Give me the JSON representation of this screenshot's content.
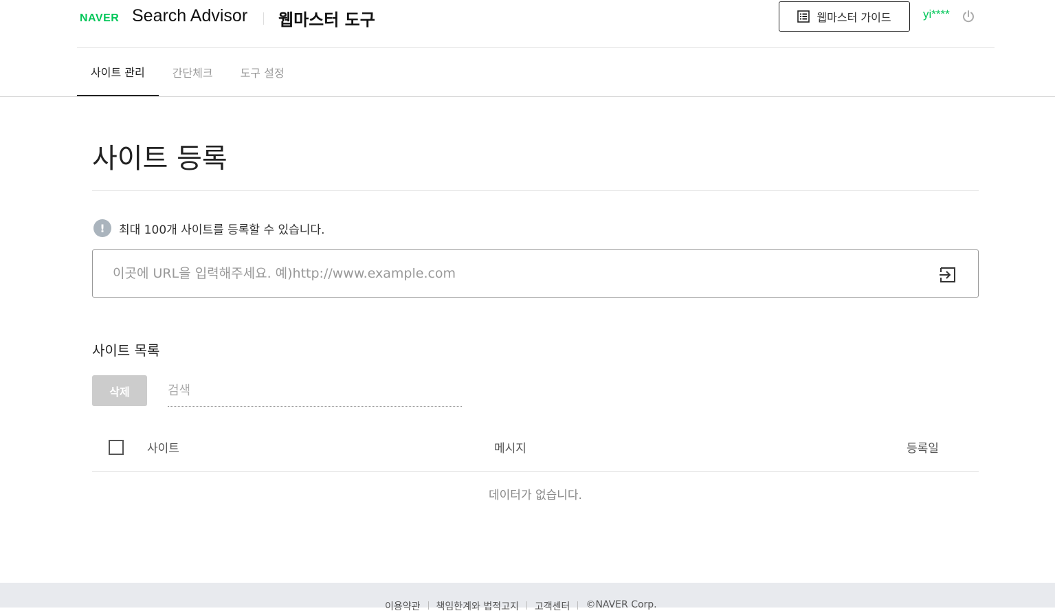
{
  "header": {
    "logo": "NAVER",
    "brand": "Search Advisor",
    "tool_title": "웹마스터 도구",
    "guide_label": "웹마스터 가이드",
    "user": "yi****"
  },
  "tabs": [
    {
      "label": "사이트 관리",
      "active": true
    },
    {
      "label": "간단체크",
      "active": false
    },
    {
      "label": "도구 설정",
      "active": false
    }
  ],
  "main": {
    "title": "사이트 등록",
    "notice": "최대 100개 사이트를 등록할 수 있습니다.",
    "url_placeholder": "이곳에 URL을 입력해주세요. 예)http://www.example.com",
    "list_title": "사이트 목록",
    "delete_label": "삭제",
    "search_placeholder": "검색",
    "columns": {
      "site": "사이트",
      "message": "메시지",
      "date": "등록일"
    },
    "empty_text": "데이터가 없습니다."
  },
  "footer": {
    "links": [
      "이용약관",
      "책임한계와 법적고지",
      "고객센터",
      "©NAVER Corp."
    ]
  },
  "colors": {
    "brand_green": "#03c75a",
    "footer_bg": "#e8eaee",
    "disabled_button": "#cccccc"
  }
}
